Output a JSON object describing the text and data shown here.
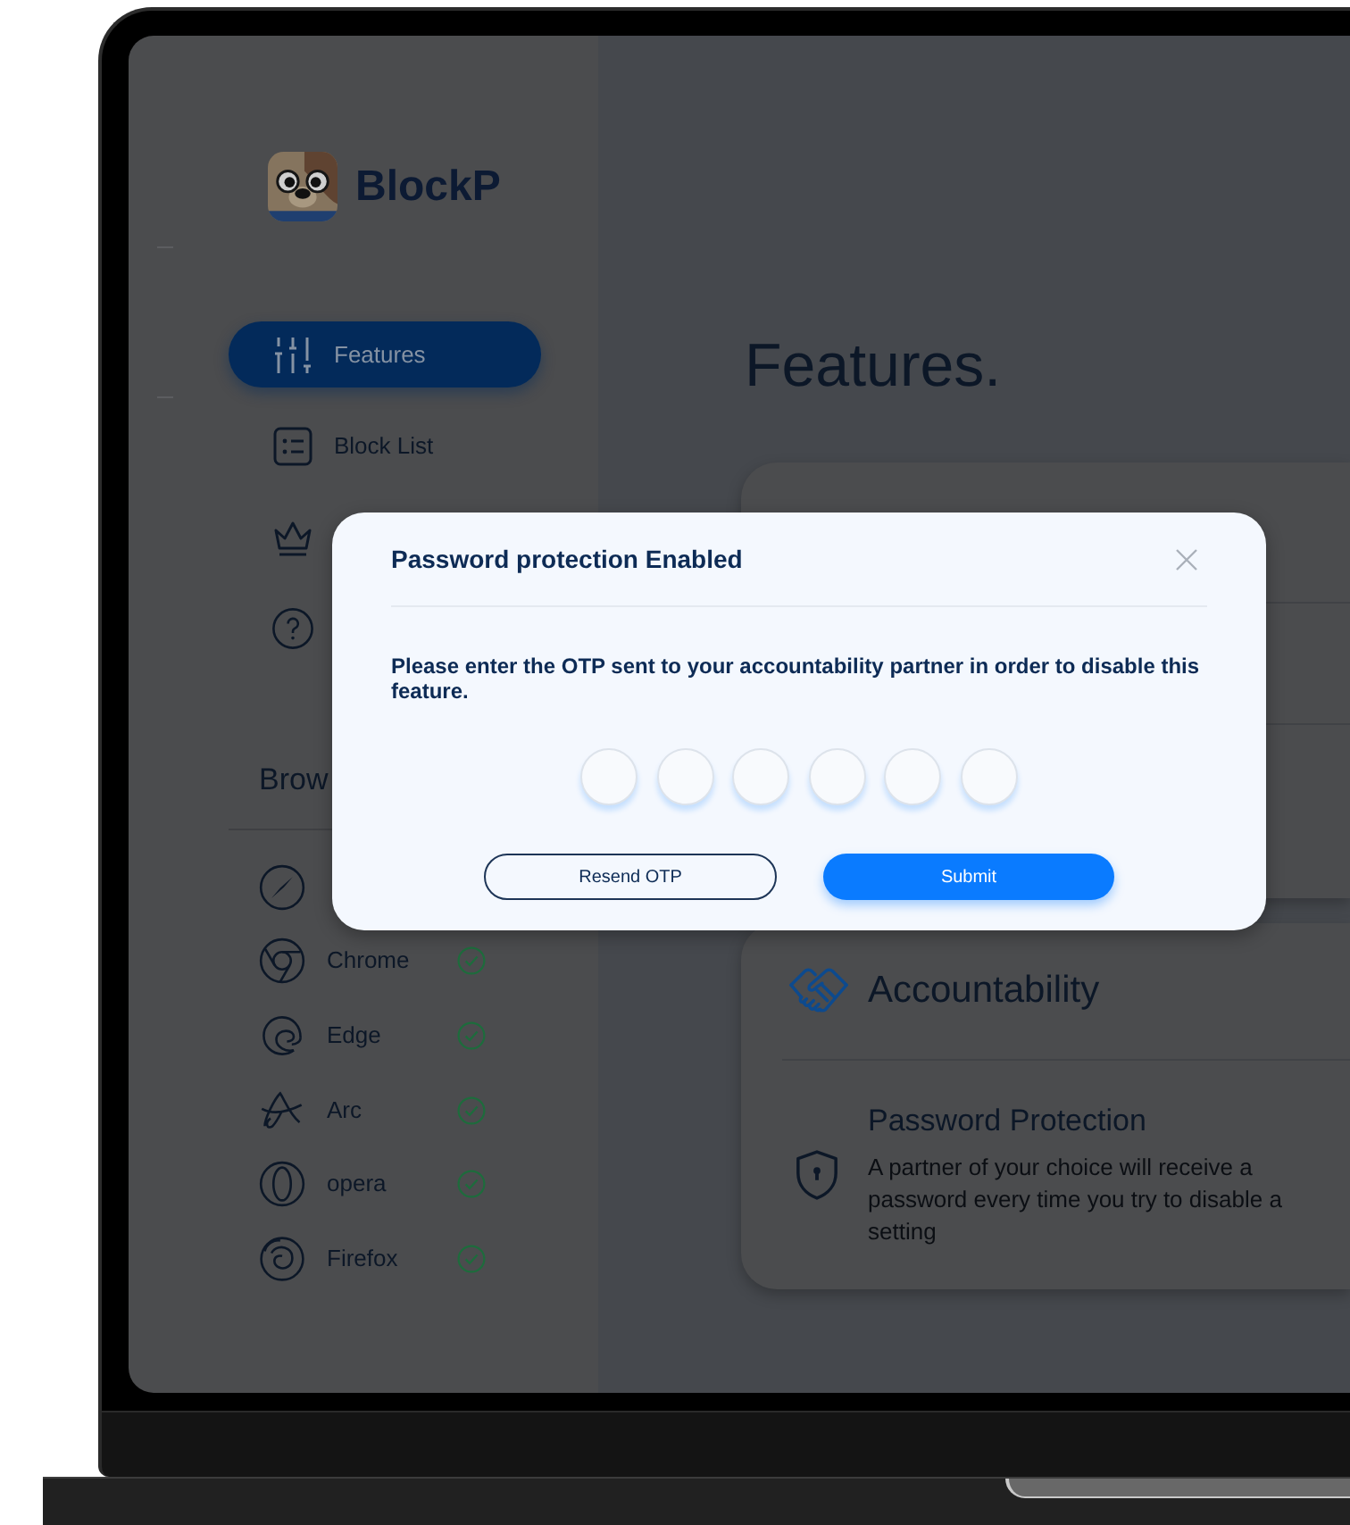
{
  "sidebar": {
    "logo": {
      "text": "BlockP"
    },
    "nav_items": [
      {
        "label": "Features",
        "selected": true
      },
      {
        "label": "Block List",
        "selected": false
      },
      {
        "selected": false
      },
      {
        "selected": false
      }
    ],
    "browsers_heading": "Brow",
    "browsers": [
      {
        "name": "Chrome",
        "checked": true
      },
      {
        "name": "Edge",
        "checked": true
      },
      {
        "name": "Arc",
        "checked": true
      },
      {
        "name": "opera",
        "checked": true
      },
      {
        "name": "Firefox",
        "checked": true
      }
    ]
  },
  "main": {
    "title": "Features.",
    "cards": [
      {
        "title": "Accountability",
        "items": [
          {
            "title": "Password Protection",
            "description": "A partner of your choice will receive a password every time you try to disable a setting"
          }
        ]
      }
    ]
  },
  "dialog": {
    "title": "Password protection Enabled",
    "message": "Please enter the OTP sent to your accountability partner in order to disable this feature.",
    "buttons": [
      {
        "label": "Resend OTP",
        "kind": "secondary"
      },
      {
        "label": "Submit",
        "kind": "primary"
      }
    ]
  }
}
